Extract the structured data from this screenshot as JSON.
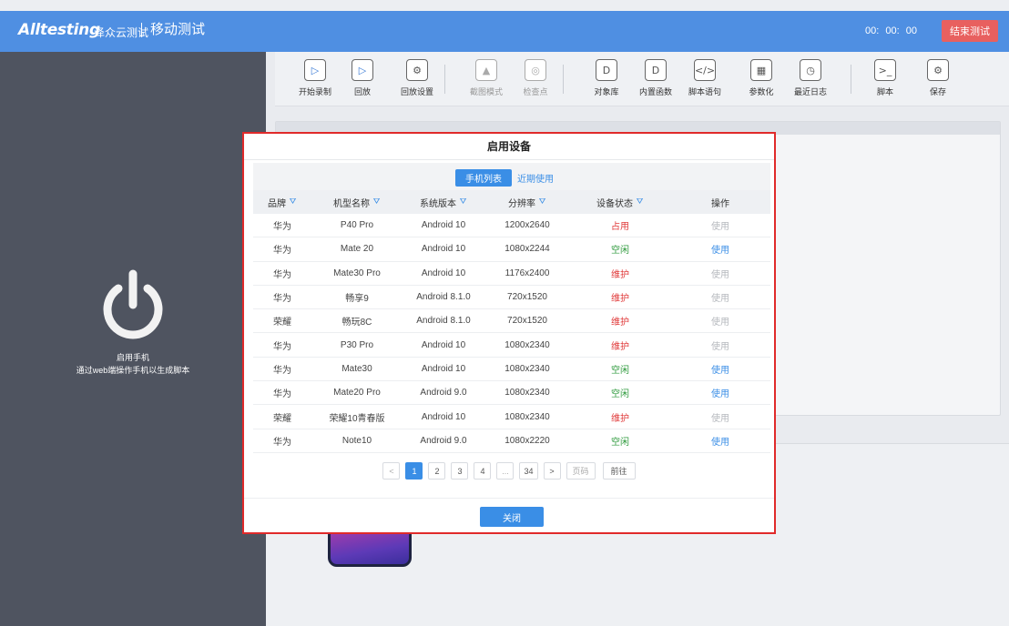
{
  "header": {
    "brand": "Alltesting",
    "brand_sub": "泽众云测试",
    "page_name": "移动测试",
    "timer": "00:  00:  00",
    "end_button": "结束测试"
  },
  "left_panel": {
    "title": "启用手机",
    "desc": "通过web端操作手机以生成脚本"
  },
  "toolbar": {
    "items": [
      {
        "label": "开始录制",
        "icon": "record-icon",
        "glyph": "▷"
      },
      {
        "label": "回放",
        "icon": "playback-icon",
        "glyph": "▷"
      },
      {
        "label": "回放设置",
        "icon": "settings-icon",
        "glyph": "⚙"
      },
      {
        "label": "截图模式",
        "icon": "screenshot-icon",
        "glyph": "▲"
      },
      {
        "label": "检查点",
        "icon": "checkpoint-icon",
        "glyph": "◎"
      },
      {
        "label": "对象库",
        "icon": "object-library-icon",
        "glyph": "D"
      },
      {
        "label": "内置函数",
        "icon": "builtin-function-icon",
        "glyph": "D"
      },
      {
        "label": "脚本语句",
        "icon": "script-statement-icon",
        "glyph": "</>"
      },
      {
        "label": "参数化",
        "icon": "parameterize-icon",
        "glyph": "▦"
      },
      {
        "label": "最近日志",
        "icon": "recent-log-icon",
        "glyph": "◷"
      },
      {
        "label": "脚本",
        "icon": "script-icon",
        "glyph": ">_"
      },
      {
        "label": "保存",
        "icon": "save-icon",
        "glyph": "⚙"
      }
    ]
  },
  "modal": {
    "title": "启用设备",
    "tabs": [
      "手机列表",
      "近期使用"
    ],
    "columns": [
      "品牌",
      "机型名称",
      "系统版本",
      "分辨率",
      "设备状态",
      "操作"
    ],
    "rows": [
      {
        "brand": "华为",
        "model": "P40 Pro",
        "os": "Android 10",
        "res": "1200x2640",
        "status": "占用",
        "status_type": "busy",
        "op": "使用",
        "op_enabled": false
      },
      {
        "brand": "华为",
        "model": "Mate 20",
        "os": "Android 10",
        "res": "1080x2244",
        "status": "空闲",
        "status_type": "free",
        "op": "使用",
        "op_enabled": true
      },
      {
        "brand": "华为",
        "model": "Mate30 Pro",
        "os": "Android 10",
        "res": "1176x2400",
        "status": "维护",
        "status_type": "maint",
        "op": "使用",
        "op_enabled": false
      },
      {
        "brand": "华为",
        "model": "畅享9",
        "os": "Android 8.1.0",
        "res": "720x1520",
        "status": "维护",
        "status_type": "maint",
        "op": "使用",
        "op_enabled": false
      },
      {
        "brand": "荣耀",
        "model": "畅玩8C",
        "os": "Android 8.1.0",
        "res": "720x1520",
        "status": "维护",
        "status_type": "maint",
        "op": "使用",
        "op_enabled": false
      },
      {
        "brand": "华为",
        "model": "P30 Pro",
        "os": "Android 10",
        "res": "1080x2340",
        "status": "维护",
        "status_type": "maint",
        "op": "使用",
        "op_enabled": false
      },
      {
        "brand": "华为",
        "model": "Mate30",
        "os": "Android 10",
        "res": "1080x2340",
        "status": "空闲",
        "status_type": "free",
        "op": "使用",
        "op_enabled": true
      },
      {
        "brand": "华为",
        "model": "Mate20 Pro",
        "os": "Android 9.0",
        "res": "1080x2340",
        "status": "空闲",
        "status_type": "free",
        "op": "使用",
        "op_enabled": true
      },
      {
        "brand": "荣耀",
        "model": "荣耀10青春版",
        "os": "Android 10",
        "res": "1080x2340",
        "status": "维护",
        "status_type": "maint",
        "op": "使用",
        "op_enabled": false
      },
      {
        "brand": "华为",
        "model": "Note10",
        "os": "Android 9.0",
        "res": "1080x2220",
        "status": "空闲",
        "status_type": "free",
        "op": "使用",
        "op_enabled": true
      }
    ],
    "pager": {
      "prev": "<",
      "pages": [
        "1",
        "2",
        "3",
        "4",
        "...",
        "34"
      ],
      "current": "1",
      "next": ">",
      "page_input_placeholder": "页码",
      "go": "前往"
    },
    "close_button": "关闭"
  },
  "colors": {
    "header_bg": "#4f8fe2",
    "left_panel_bg": "#4f5460",
    "accent": "#3a8ee6",
    "end_button": "#e8605f",
    "modal_border": "#e02a2a",
    "status_free": "#2e9a3c",
    "status_busy": "#e03a3a"
  }
}
